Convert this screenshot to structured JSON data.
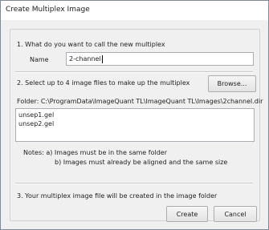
{
  "window": {
    "title": "Create Multiplex Image"
  },
  "section1": {
    "prompt": "1. What do you want to call the new multiplex",
    "name_label": "Name",
    "name_value": "2-channel"
  },
  "section2": {
    "prompt": "2. Select up to 4 image files to make up the multiplex",
    "browse_label": "Browse...",
    "folder_text": "Folder: C:\\ProgramData\\ImageQuant TL\\ImageQuant TL\\Images\\2channel.dir",
    "files": [
      "unsep1.gel",
      "unsep2.gel"
    ],
    "note_a": "Notes: a) Images must be in the same folder",
    "note_b": "b) Images must already be aligned and the same size"
  },
  "section3": {
    "info": "3. Your multiplex image file will be created in the image folder",
    "create_label": "Create",
    "cancel_label": "Cancel"
  }
}
